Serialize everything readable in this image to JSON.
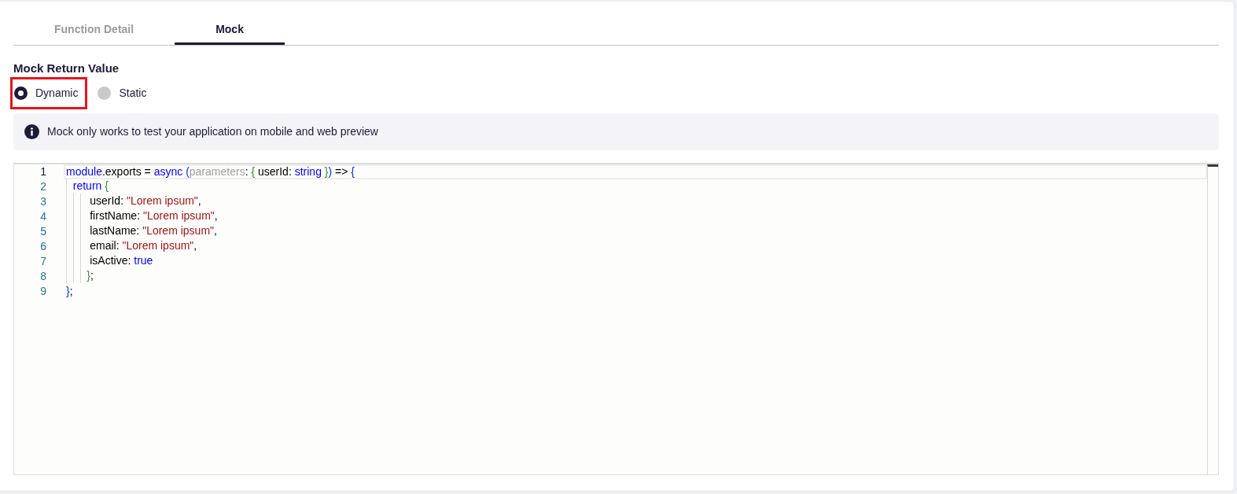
{
  "tabs": [
    {
      "label": "Function Detail",
      "selected": false
    },
    {
      "label": "Mock",
      "selected": true
    }
  ],
  "mock_return_value": {
    "title": "Mock Return Value",
    "options": [
      {
        "label": "Dynamic",
        "selected": true,
        "highlighted": true
      },
      {
        "label": "Static",
        "selected": false,
        "highlighted": false
      }
    ]
  },
  "info_banner": {
    "text": "Mock only works to test your application on mobile and web preview"
  },
  "editor": {
    "lines": [
      {
        "number": "1",
        "current": true,
        "tokens": [
          {
            "text": "module",
            "kind": "keyword"
          },
          {
            "text": ".exports = ",
            "kind": "plain"
          },
          {
            "text": "async ",
            "kind": "keyword"
          },
          {
            "text": "(",
            "kind": "bracket1"
          },
          {
            "text": "parameters",
            "kind": "param"
          },
          {
            "text": ": ",
            "kind": "plain"
          },
          {
            "text": "{",
            "kind": "bracket2"
          },
          {
            "text": " userId: ",
            "kind": "plain"
          },
          {
            "text": "string ",
            "kind": "keyword"
          },
          {
            "text": "}",
            "kind": "bracket2"
          },
          {
            "text": ")",
            "kind": "bracket1"
          },
          {
            "text": " => ",
            "kind": "plain"
          },
          {
            "text": "{",
            "kind": "bracket1"
          }
        ]
      },
      {
        "number": "2",
        "current": false,
        "tokens": [
          {
            "text": "  return ",
            "kind": "keyword"
          },
          {
            "text": "{",
            "kind": "bracket2"
          }
        ]
      },
      {
        "number": "3",
        "current": false,
        "tokens": [
          {
            "text": "       userId: ",
            "kind": "plain"
          },
          {
            "text": "\"Lorem ipsum\"",
            "kind": "string"
          },
          {
            "text": ",",
            "kind": "plain"
          }
        ]
      },
      {
        "number": "4",
        "current": false,
        "tokens": [
          {
            "text": "       firstName: ",
            "kind": "plain"
          },
          {
            "text": "\"Lorem ipsum\"",
            "kind": "string"
          },
          {
            "text": ",",
            "kind": "plain"
          }
        ]
      },
      {
        "number": "5",
        "current": false,
        "tokens": [
          {
            "text": "       lastName: ",
            "kind": "plain"
          },
          {
            "text": "\"Lorem ipsum\"",
            "kind": "string"
          },
          {
            "text": ",",
            "kind": "plain"
          }
        ]
      },
      {
        "number": "6",
        "current": false,
        "tokens": [
          {
            "text": "       email: ",
            "kind": "plain"
          },
          {
            "text": "\"Lorem ipsum\"",
            "kind": "string"
          },
          {
            "text": ",",
            "kind": "plain"
          }
        ]
      },
      {
        "number": "7",
        "current": false,
        "tokens": [
          {
            "text": "       isActive: ",
            "kind": "plain"
          },
          {
            "text": "true",
            "kind": "keyword"
          }
        ]
      },
      {
        "number": "8",
        "current": false,
        "tokens": [
          {
            "text": "      }",
            "kind": "bracket2"
          },
          {
            "text": ";",
            "kind": "plain"
          }
        ]
      },
      {
        "number": "9",
        "current": false,
        "tokens": [
          {
            "text": "}",
            "kind": "bracket1"
          },
          {
            "text": ";",
            "kind": "plain"
          }
        ]
      }
    ]
  }
}
